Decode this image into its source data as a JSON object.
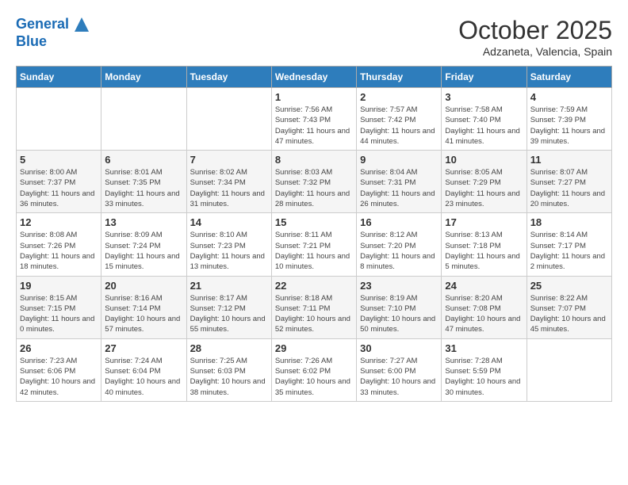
{
  "header": {
    "logo_line1": "General",
    "logo_line2": "Blue",
    "month_title": "October 2025",
    "location": "Adzaneta, Valencia, Spain"
  },
  "days_of_week": [
    "Sunday",
    "Monday",
    "Tuesday",
    "Wednesday",
    "Thursday",
    "Friday",
    "Saturday"
  ],
  "weeks": [
    [
      {
        "day": "",
        "sunrise": "",
        "sunset": "",
        "daylight": ""
      },
      {
        "day": "",
        "sunrise": "",
        "sunset": "",
        "daylight": ""
      },
      {
        "day": "",
        "sunrise": "",
        "sunset": "",
        "daylight": ""
      },
      {
        "day": "1",
        "sunrise": "Sunrise: 7:56 AM",
        "sunset": "Sunset: 7:43 PM",
        "daylight": "Daylight: 11 hours and 47 minutes."
      },
      {
        "day": "2",
        "sunrise": "Sunrise: 7:57 AM",
        "sunset": "Sunset: 7:42 PM",
        "daylight": "Daylight: 11 hours and 44 minutes."
      },
      {
        "day": "3",
        "sunrise": "Sunrise: 7:58 AM",
        "sunset": "Sunset: 7:40 PM",
        "daylight": "Daylight: 11 hours and 41 minutes."
      },
      {
        "day": "4",
        "sunrise": "Sunrise: 7:59 AM",
        "sunset": "Sunset: 7:39 PM",
        "daylight": "Daylight: 11 hours and 39 minutes."
      }
    ],
    [
      {
        "day": "5",
        "sunrise": "Sunrise: 8:00 AM",
        "sunset": "Sunset: 7:37 PM",
        "daylight": "Daylight: 11 hours and 36 minutes."
      },
      {
        "day": "6",
        "sunrise": "Sunrise: 8:01 AM",
        "sunset": "Sunset: 7:35 PM",
        "daylight": "Daylight: 11 hours and 33 minutes."
      },
      {
        "day": "7",
        "sunrise": "Sunrise: 8:02 AM",
        "sunset": "Sunset: 7:34 PM",
        "daylight": "Daylight: 11 hours and 31 minutes."
      },
      {
        "day": "8",
        "sunrise": "Sunrise: 8:03 AM",
        "sunset": "Sunset: 7:32 PM",
        "daylight": "Daylight: 11 hours and 28 minutes."
      },
      {
        "day": "9",
        "sunrise": "Sunrise: 8:04 AM",
        "sunset": "Sunset: 7:31 PM",
        "daylight": "Daylight: 11 hours and 26 minutes."
      },
      {
        "day": "10",
        "sunrise": "Sunrise: 8:05 AM",
        "sunset": "Sunset: 7:29 PM",
        "daylight": "Daylight: 11 hours and 23 minutes."
      },
      {
        "day": "11",
        "sunrise": "Sunrise: 8:07 AM",
        "sunset": "Sunset: 7:27 PM",
        "daylight": "Daylight: 11 hours and 20 minutes."
      }
    ],
    [
      {
        "day": "12",
        "sunrise": "Sunrise: 8:08 AM",
        "sunset": "Sunset: 7:26 PM",
        "daylight": "Daylight: 11 hours and 18 minutes."
      },
      {
        "day": "13",
        "sunrise": "Sunrise: 8:09 AM",
        "sunset": "Sunset: 7:24 PM",
        "daylight": "Daylight: 11 hours and 15 minutes."
      },
      {
        "day": "14",
        "sunrise": "Sunrise: 8:10 AM",
        "sunset": "Sunset: 7:23 PM",
        "daylight": "Daylight: 11 hours and 13 minutes."
      },
      {
        "day": "15",
        "sunrise": "Sunrise: 8:11 AM",
        "sunset": "Sunset: 7:21 PM",
        "daylight": "Daylight: 11 hours and 10 minutes."
      },
      {
        "day": "16",
        "sunrise": "Sunrise: 8:12 AM",
        "sunset": "Sunset: 7:20 PM",
        "daylight": "Daylight: 11 hours and 8 minutes."
      },
      {
        "day": "17",
        "sunrise": "Sunrise: 8:13 AM",
        "sunset": "Sunset: 7:18 PM",
        "daylight": "Daylight: 11 hours and 5 minutes."
      },
      {
        "day": "18",
        "sunrise": "Sunrise: 8:14 AM",
        "sunset": "Sunset: 7:17 PM",
        "daylight": "Daylight: 11 hours and 2 minutes."
      }
    ],
    [
      {
        "day": "19",
        "sunrise": "Sunrise: 8:15 AM",
        "sunset": "Sunset: 7:15 PM",
        "daylight": "Daylight: 11 hours and 0 minutes."
      },
      {
        "day": "20",
        "sunrise": "Sunrise: 8:16 AM",
        "sunset": "Sunset: 7:14 PM",
        "daylight": "Daylight: 10 hours and 57 minutes."
      },
      {
        "day": "21",
        "sunrise": "Sunrise: 8:17 AM",
        "sunset": "Sunset: 7:12 PM",
        "daylight": "Daylight: 10 hours and 55 minutes."
      },
      {
        "day": "22",
        "sunrise": "Sunrise: 8:18 AM",
        "sunset": "Sunset: 7:11 PM",
        "daylight": "Daylight: 10 hours and 52 minutes."
      },
      {
        "day": "23",
        "sunrise": "Sunrise: 8:19 AM",
        "sunset": "Sunset: 7:10 PM",
        "daylight": "Daylight: 10 hours and 50 minutes."
      },
      {
        "day": "24",
        "sunrise": "Sunrise: 8:20 AM",
        "sunset": "Sunset: 7:08 PM",
        "daylight": "Daylight: 10 hours and 47 minutes."
      },
      {
        "day": "25",
        "sunrise": "Sunrise: 8:22 AM",
        "sunset": "Sunset: 7:07 PM",
        "daylight": "Daylight: 10 hours and 45 minutes."
      }
    ],
    [
      {
        "day": "26",
        "sunrise": "Sunrise: 7:23 AM",
        "sunset": "Sunset: 6:06 PM",
        "daylight": "Daylight: 10 hours and 42 minutes."
      },
      {
        "day": "27",
        "sunrise": "Sunrise: 7:24 AM",
        "sunset": "Sunset: 6:04 PM",
        "daylight": "Daylight: 10 hours and 40 minutes."
      },
      {
        "day": "28",
        "sunrise": "Sunrise: 7:25 AM",
        "sunset": "Sunset: 6:03 PM",
        "daylight": "Daylight: 10 hours and 38 minutes."
      },
      {
        "day": "29",
        "sunrise": "Sunrise: 7:26 AM",
        "sunset": "Sunset: 6:02 PM",
        "daylight": "Daylight: 10 hours and 35 minutes."
      },
      {
        "day": "30",
        "sunrise": "Sunrise: 7:27 AM",
        "sunset": "Sunset: 6:00 PM",
        "daylight": "Daylight: 10 hours and 33 minutes."
      },
      {
        "day": "31",
        "sunrise": "Sunrise: 7:28 AM",
        "sunset": "Sunset: 5:59 PM",
        "daylight": "Daylight: 10 hours and 30 minutes."
      },
      {
        "day": "",
        "sunrise": "",
        "sunset": "",
        "daylight": ""
      }
    ]
  ]
}
